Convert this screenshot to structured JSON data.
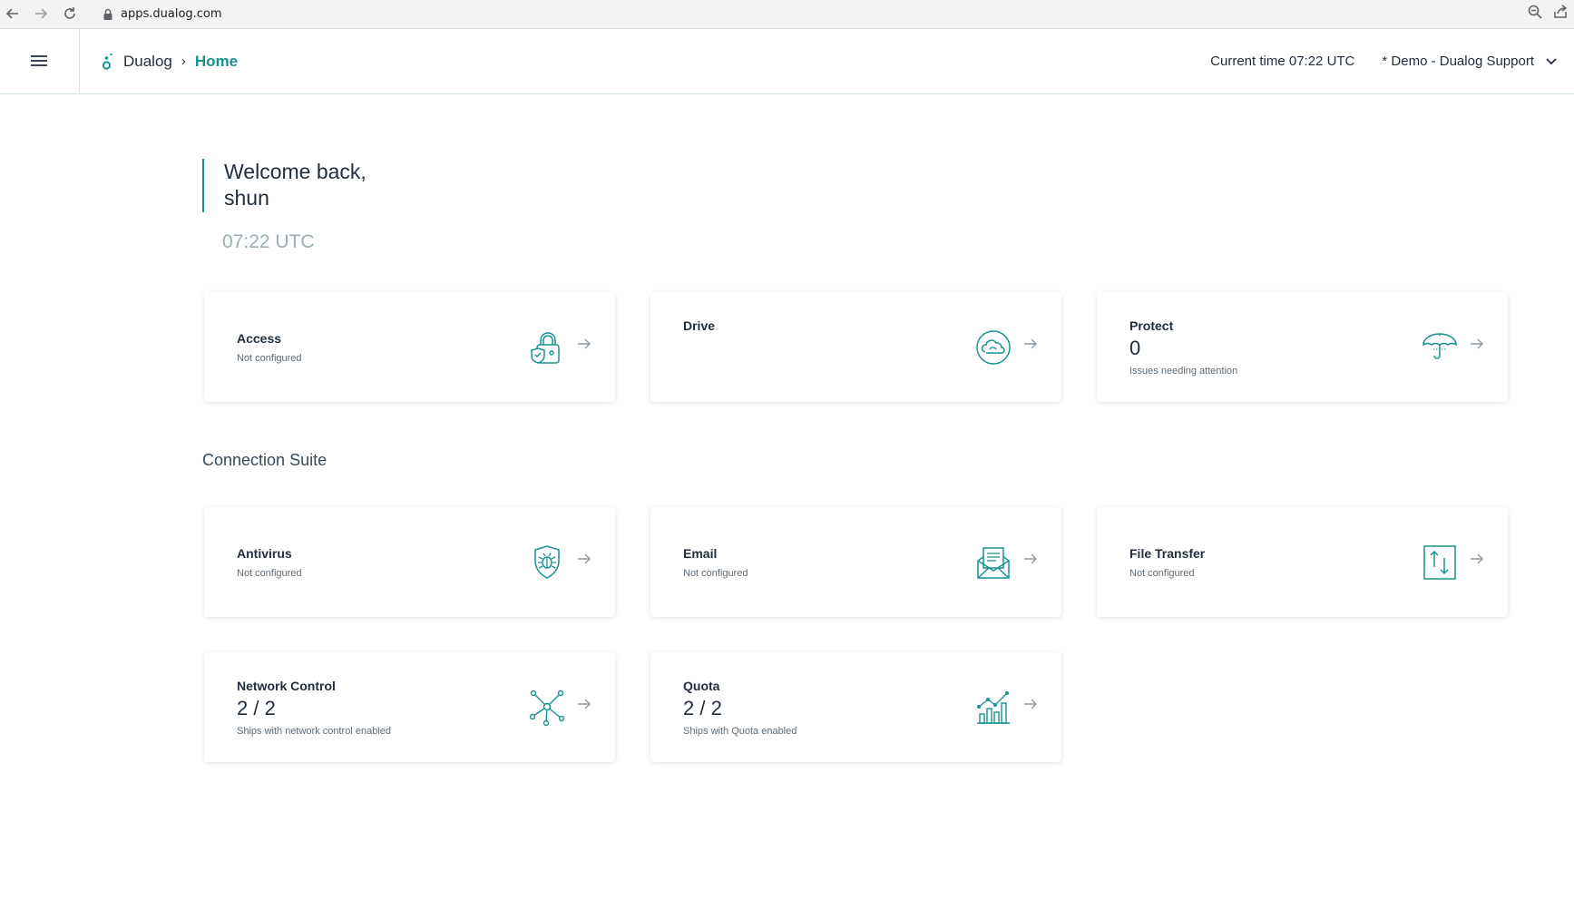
{
  "browser": {
    "url": "apps.dualog.com"
  },
  "header": {
    "brand": "Dualog",
    "breadcrumb_separator": "›",
    "page": "Home",
    "current_time": "Current time 07:22 UTC",
    "organization": "* Demo - Dualog Support"
  },
  "welcome": {
    "line1": "Welcome back,",
    "line2": "shun",
    "clock": "07:22 UTC"
  },
  "cards_top": {
    "access": {
      "title": "Access",
      "subtitle": "Not configured",
      "icon": "lock-shield-icon"
    },
    "drive": {
      "title": "Drive",
      "icon": "cloud-icon"
    },
    "protect": {
      "title": "Protect",
      "value": "0",
      "subtitle": "Issues needing attention",
      "icon": "umbrella-icon"
    }
  },
  "section": {
    "title": "Connection Suite"
  },
  "cards_suite": {
    "antivirus": {
      "title": "Antivirus",
      "subtitle": "Not configured",
      "icon": "bug-shield-icon"
    },
    "email": {
      "title": "Email",
      "subtitle": "Not configured",
      "icon": "envelope-icon"
    },
    "file_transfer": {
      "title": "File Transfer",
      "subtitle": "Not configured",
      "icon": "transfer-icon"
    },
    "network_control": {
      "title": "Network Control",
      "value": "2 / 2",
      "subtitle": "Ships with network control enabled",
      "icon": "network-icon"
    },
    "quota": {
      "title": "Quota",
      "value": "2 / 2",
      "subtitle": "Ships with Quota enabled",
      "icon": "bar-chart-icon"
    }
  },
  "colors": {
    "accent": "#16928f",
    "text": "#1f2d3d",
    "muted": "#9aaeb6"
  }
}
